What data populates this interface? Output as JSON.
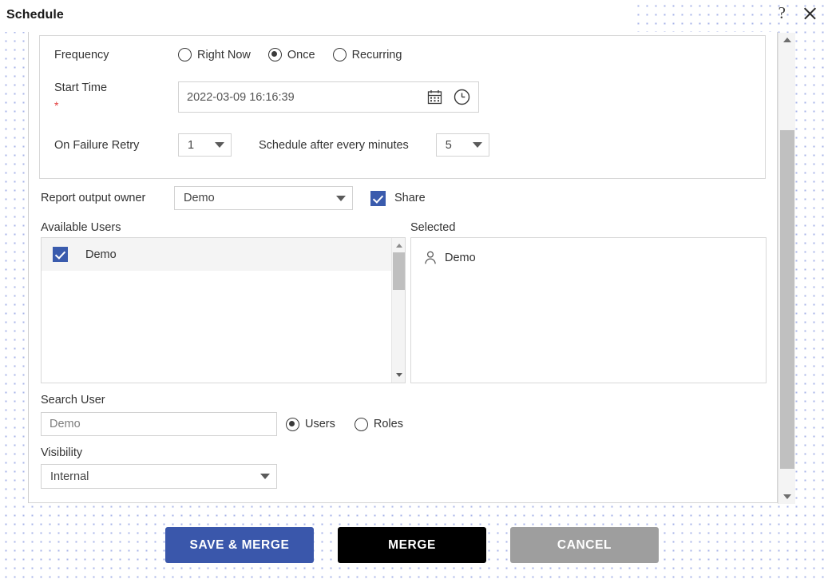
{
  "dialog": {
    "title": "Schedule",
    "help_icon": "question-mark-icon",
    "close_icon": "close-icon"
  },
  "schedule": {
    "frequency": {
      "label": "Frequency",
      "options": [
        {
          "label": "Right Now",
          "selected": false
        },
        {
          "label": "Once",
          "selected": true
        },
        {
          "label": "Recurring",
          "selected": false
        }
      ]
    },
    "start_time": {
      "label": "Start Time",
      "required_marker": "*",
      "value": "2022-03-09 16:16:39",
      "calendar_icon": "calendar-icon",
      "clock_icon": "clock-icon"
    },
    "on_failure_retry": {
      "label": "On Failure Retry",
      "retry_count": "1",
      "interval_label": "Schedule after every minutes",
      "interval_value": "5"
    }
  },
  "report_output": {
    "label": "Report output owner",
    "owner_value": "Demo",
    "share_label": "Share",
    "share_checked": true
  },
  "users": {
    "available_label": "Available Users",
    "available_items": [
      {
        "name": "Demo",
        "checked": true
      }
    ],
    "selected_label": "Selected",
    "selected_items": [
      {
        "name": "Demo",
        "icon": "user-icon"
      }
    ]
  },
  "search": {
    "label": "Search User",
    "placeholder": "Demo",
    "value": "",
    "scope_options": [
      {
        "label": "Users",
        "selected": true
      },
      {
        "label": "Roles",
        "selected": false
      }
    ]
  },
  "visibility": {
    "label": "Visibility",
    "value": "Internal"
  },
  "footer": {
    "save_merge_label": "SAVE & MERGE",
    "merge_label": "MERGE",
    "cancel_label": "CANCEL"
  },
  "colors": {
    "primary": "#3a57ab",
    "dark": "#000000",
    "muted": "#9e9e9e",
    "checkbox": "#3a5bad",
    "required": "#e23b3b",
    "dot_pattern": "#a8b4e8"
  }
}
